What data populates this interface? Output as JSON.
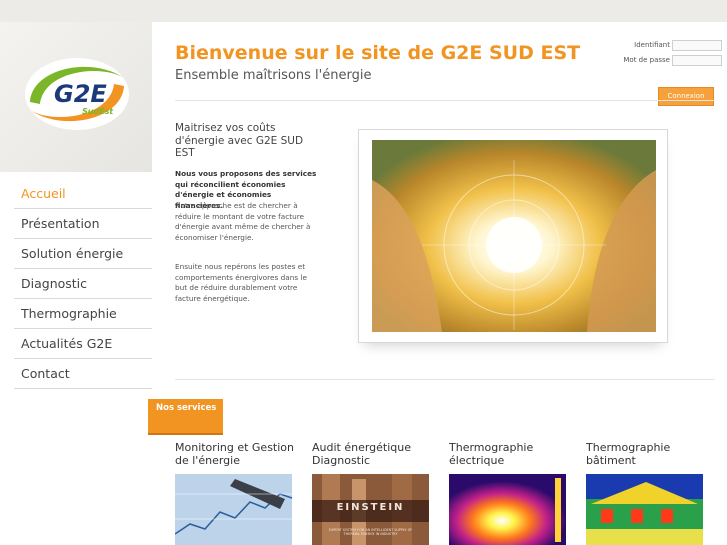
{
  "brand": {
    "logo_text": "G2E",
    "logo_sub": "SudEst",
    "colors": {
      "accent": "#f29422",
      "green": "#7ab628",
      "navy": "#1a3a7a"
    }
  },
  "nav": {
    "items": [
      {
        "label": "Accueil",
        "active": true
      },
      {
        "label": "Présentation"
      },
      {
        "label": "Solution énergie"
      },
      {
        "label": "Diagnostic"
      },
      {
        "label": "Thermographie"
      },
      {
        "label": "Actualités G2E"
      },
      {
        "label": "Contact"
      }
    ]
  },
  "header": {
    "title": "Bienvenue sur le site de G2E SUD EST",
    "subtitle": "Ensemble maîtrisons l'énergie"
  },
  "login": {
    "id_label": "Identifiant",
    "password_label": "Mot de passe",
    "id_value": "",
    "password_value": "",
    "button_label": "Connexion"
  },
  "intro": {
    "heading": "Maitrisez vos coûts d'énergie avec G2E SUD EST",
    "bold": "Nous vous proposons des services qui réconcilient économies d'énergie et économies financières.",
    "text1": "Notre approche est de chercher à réduire le montant de votre facture d'énergie avant même de chercher à économiser l'énergie.",
    "text2": "Ensuite nous repérons les postes et comportements énergivores dans le but de réduire durablement votre facture énergétique."
  },
  "services": {
    "tab_label": "Nos services",
    "items": [
      {
        "title": "Monitoring et Gestion de l'énergie"
      },
      {
        "title": "Audit énergétique Diagnostic",
        "image_caption": "EINSTEIN",
        "image_subcaption": "EXPERT SYSTEM FOR AN INTELLIGENT SUPPLY OF THERMAL ENERGY IN INDUSTRY"
      },
      {
        "title": "Thermographie électrique"
      },
      {
        "title": "Thermographie bâtiment"
      }
    ]
  }
}
